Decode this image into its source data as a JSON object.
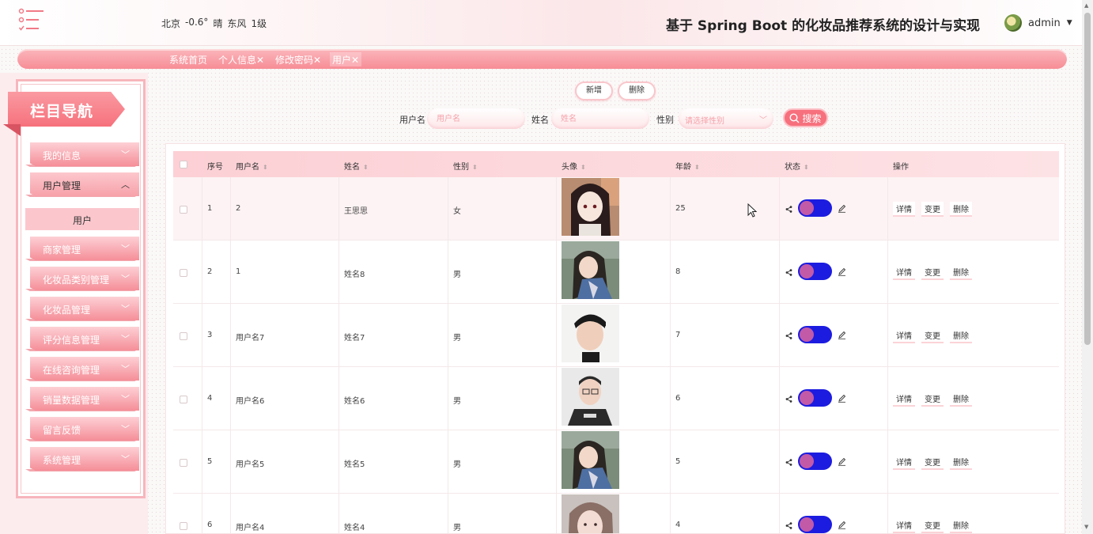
{
  "header": {
    "weather": [
      "北京",
      "-0.6°",
      "晴",
      "东风",
      "1级"
    ],
    "title": "基于 Spring Boot 的化妆品推荐系统的设计与实现",
    "user": "admin"
  },
  "tabs": [
    {
      "label": "系统首页"
    },
    {
      "label": "个人信息✕"
    },
    {
      "label": "修改密码✕"
    },
    {
      "label": "用户✕"
    }
  ],
  "sidebar": {
    "banner": "栏目导航",
    "items": [
      {
        "label": "我的信息"
      },
      {
        "label": "用户管理"
      },
      {
        "label": "商家管理"
      },
      {
        "label": "化妆品类别管理"
      },
      {
        "label": "化妆品管理"
      },
      {
        "label": "评分信息管理"
      },
      {
        "label": "在线咨询管理"
      },
      {
        "label": "销量数据管理"
      },
      {
        "label": "留言反馈"
      },
      {
        "label": "系统管理"
      }
    ],
    "sub_item": "用户"
  },
  "toolbar": {
    "add": "新增",
    "delete": "删除",
    "username_label": "用户名",
    "username_placeholder": "用户名",
    "name_label": "姓名",
    "name_placeholder": "姓名",
    "gender_label": "性别",
    "gender_placeholder": "请选择性别",
    "search": "搜索"
  },
  "table": {
    "columns": [
      "序号",
      "用户名",
      "姓名",
      "性别",
      "头像",
      "年龄",
      "状态",
      "操作"
    ],
    "actions": [
      "详情",
      "变更",
      "删除"
    ],
    "rows": [
      {
        "index": "1",
        "username": "2",
        "name": "王思思",
        "gender": "女",
        "age": "25"
      },
      {
        "index": "2",
        "username": "1",
        "name": "姓名8",
        "gender": "男",
        "age": "8"
      },
      {
        "index": "3",
        "username": "用户名7",
        "name": "姓名7",
        "gender": "男",
        "age": "7"
      },
      {
        "index": "4",
        "username": "用户名6",
        "name": "姓名6",
        "gender": "男",
        "age": "6"
      },
      {
        "index": "5",
        "username": "用户名5",
        "name": "姓名5",
        "gender": "男",
        "age": "5"
      },
      {
        "index": "6",
        "username": "用户名4",
        "name": "姓名4",
        "gender": "男",
        "age": "4"
      }
    ]
  },
  "colors": {
    "accent": "#f7707d",
    "toggle": "#1c1ce0",
    "knob": "#c25aa8"
  }
}
